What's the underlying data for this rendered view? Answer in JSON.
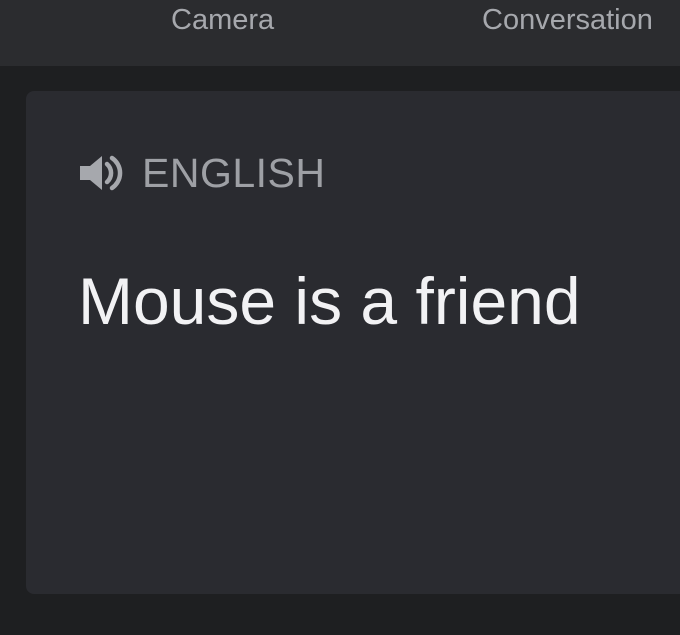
{
  "tabs": {
    "camera": "Camera",
    "conversation": "Conversation"
  },
  "result": {
    "language": "ENGLISH",
    "text": "Mouse is a friend",
    "speaker_icon": "speaker-icon"
  },
  "colors": {
    "background": "#1e1f21",
    "top_bar": "#2b2c2f",
    "card": "#2a2b30",
    "tab_text": "#a6a8ad",
    "language_text": "#9ea0a5",
    "translation_text": "#f2f2f4"
  }
}
